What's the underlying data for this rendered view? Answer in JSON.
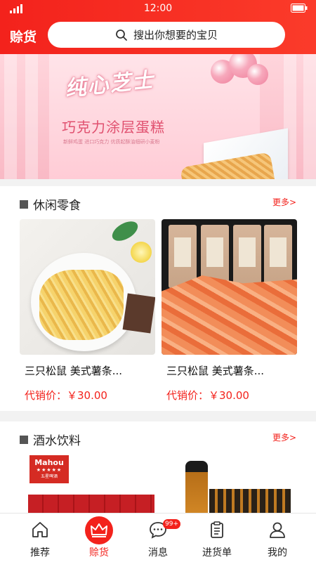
{
  "status_bar": {
    "time": "12:00"
  },
  "header": {
    "brand": "赊货",
    "search_placeholder": "搜出你想要的宝贝"
  },
  "banner": {
    "script_text": "纯心芝士",
    "headline": "巧克力涂层蛋糕",
    "subline": "新鲜鸡蛋 进口巧克力 优质起酥油细研小麦粉"
  },
  "sections": [
    {
      "title": "休闲零食",
      "more": "更多>",
      "products": [
        {
          "name": "三只松鼠 美式薯条...",
          "price": "代销价：￥30.00"
        },
        {
          "name": "三只松鼠 美式薯条...",
          "price": "代销价：￥30.00"
        }
      ]
    },
    {
      "title": "酒水饮料",
      "more": "更多>",
      "logo_text": "Mahou",
      "logo_stars": "★★★★★",
      "logo_sub": "五星啤酒"
    }
  ],
  "tabbar": {
    "items": [
      {
        "label": "推荐",
        "icon": "home-icon"
      },
      {
        "label": "赊货",
        "icon": "crown-icon",
        "active": true
      },
      {
        "label": "消息",
        "icon": "message-icon",
        "badge": "99+"
      },
      {
        "label": "进货单",
        "icon": "clipboard-icon"
      },
      {
        "label": "我的",
        "icon": "user-icon"
      }
    ]
  },
  "colors": {
    "brand_red": "#f3221c",
    "banner_pink": "#ffd5dc"
  }
}
